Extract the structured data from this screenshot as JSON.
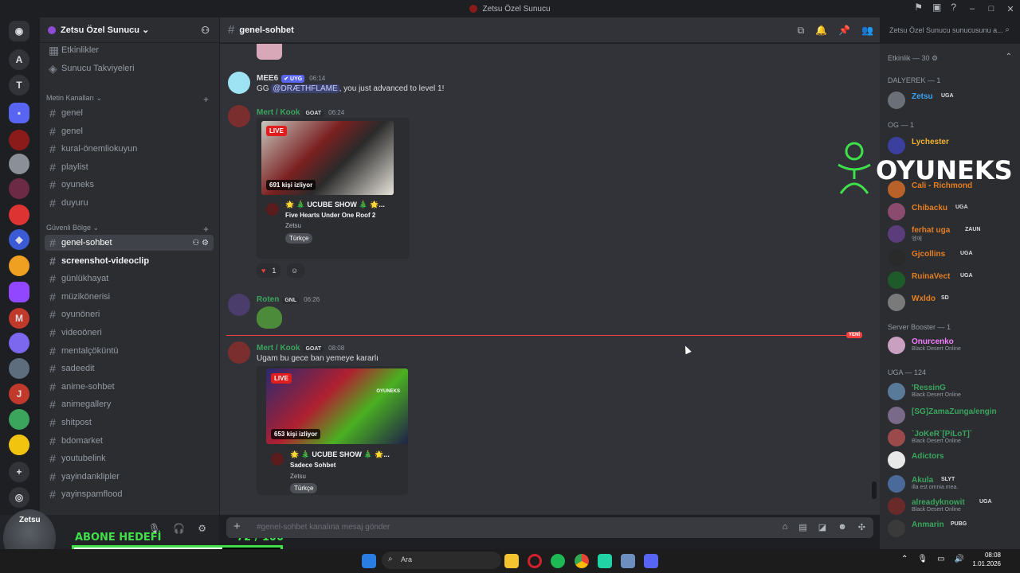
{
  "window": {
    "title": "Zetsu Özel Sunucu"
  },
  "server": {
    "name": "Zetsu Özel Sunucu ⌄"
  },
  "channel_list": {
    "top_items": [
      "Etkinlikler",
      "Sunucu Takviyeleri"
    ],
    "cat1": "Metin Kanalları ⌄",
    "cat1_channels": [
      "genel",
      "genel",
      "kural-önemliokuyun",
      "playlist",
      "oyuneks",
      "duyuru"
    ],
    "cat2": "Güvenli Bölge ⌄",
    "cat2_channels": [
      "genel-sohbet",
      "screenshot-videoclip",
      "günlükhayat",
      "müzikönerisi",
      "oyunöneri",
      "videoöneri",
      "mentalçöküntü",
      "sadeedit",
      "anime-sohbet",
      "animegallery",
      "shitpost",
      "bdomarket",
      "youtubelink",
      "yayindanklipler",
      "yayinspamflood"
    ]
  },
  "user": {
    "name": "Zetsu"
  },
  "goal": {
    "label": "ABONE HEDEFİ",
    "count": "72  / 100",
    "progress": 0.72
  },
  "chat": {
    "channel": "genel-sohbet",
    "search_placeholder": "Zetsu Özel Sunucu sunucusunu a...",
    "composer_placeholder": "#genel-sohbet kanalına mesaj gönder",
    "new_label": "YENİ",
    "messages": {
      "m1": {
        "author": "MEE6",
        "tag": "✔ UYG",
        "time": "06:14",
        "text_pre": "GG ",
        "mention": "@DRÆTHFLAME",
        "text_post": ", you just advanced to level 1!"
      },
      "m2": {
        "author": "Mert / Kook",
        "tag": "GOAT",
        "time": "06:24",
        "live": "LIVE",
        "viewers": "691 kişi izliyor",
        "card_title": "🌟 🎄 UCUBE SHOW 🎄 🌟...",
        "card_sub": "Five Hearts Under One Roof 2",
        "card_channel": "Zetsu",
        "card_lang": "Türkçe",
        "reaction_count": "1"
      },
      "m3": {
        "author": "Roten",
        "tag": "GNL",
        "time": "06:26"
      },
      "m4": {
        "author": "Mert / Kook",
        "tag": "GOAT",
        "time": "08:08",
        "text": "Ugam bu gece ban yemeye kararlı",
        "live": "LIVE",
        "viewers": "653 kişi izliyor",
        "card_title": "🌟 🎄 UCUBE SHOW 🎄 🌟...",
        "card_sub": "Sadece Sohbet",
        "card_channel": "Zetsu",
        "card_lang": "Türkçe",
        "thumb_brand": "OYUNEKS"
      }
    }
  },
  "members": {
    "header": "Etkinlik — 30",
    "groups": {
      "dalyerek": "DALYEREK — 1",
      "og": "OG — 1",
      "booster": "Server Booster — 1",
      "uga": "UGA — 124"
    },
    "list": [
      {
        "name": "Zetsu",
        "tag": "UGA",
        "status": "",
        "color": "#3ba3f5"
      },
      {
        "name": "Lychester",
        "tag": "",
        "status": "",
        "color": "#f0b232"
      },
      {
        "name": "Cali - Richmond",
        "tag": "",
        "status": "",
        "color": "#e67e22"
      },
      {
        "name": "Chibacku",
        "tag": "UGA",
        "status": "",
        "color": "#e67e22"
      },
      {
        "name": "ferhat uga",
        "tag": "ZAUN",
        "status": "엥에",
        "color": "#e67e22"
      },
      {
        "name": "Gjcollins",
        "tag": "UGA",
        "status": "",
        "color": "#e67e22"
      },
      {
        "name": "RuinaVect",
        "tag": "UGA",
        "status": "",
        "color": "#e67e22"
      },
      {
        "name": "Wxldo",
        "tag": "SD",
        "status": "",
        "color": "#e67e22"
      },
      {
        "name": "Onurcenko",
        "tag": "",
        "status": "Black Desert Online",
        "color": "#f47fff"
      },
      {
        "name": "'RessinG",
        "tag": "",
        "status": "Black Desert Online",
        "color": "#3ba55d"
      },
      {
        "name": "[SG]ZamaZunga/engin",
        "tag": "",
        "status": "",
        "color": "#3ba55d"
      },
      {
        "name": "`JoKeR`[PiLoT]`",
        "tag": "",
        "status": "Black Desert Online",
        "color": "#3ba55d"
      },
      {
        "name": "Adictors",
        "tag": "",
        "status": "",
        "color": "#3ba55d"
      },
      {
        "name": "Akula",
        "tag": "SLYT",
        "status": "illa est omnia mea.",
        "color": "#3ba55d"
      },
      {
        "name": "alreadyknowit",
        "tag": "UGA",
        "status": "Black Desert Online",
        "color": "#3ba55d"
      },
      {
        "name": "Anmarin",
        "tag": "PUBG",
        "status": "",
        "color": "#3ba55d"
      }
    ]
  },
  "overlay": {
    "brand": "OYUNEKS"
  },
  "taskbar": {
    "search": "Ara",
    "time": "08:08",
    "date": "1.01.2026"
  },
  "colors": {
    "accent": "#5865f2",
    "goal_green": "#3fe04a",
    "new_red": "#f23f42"
  }
}
